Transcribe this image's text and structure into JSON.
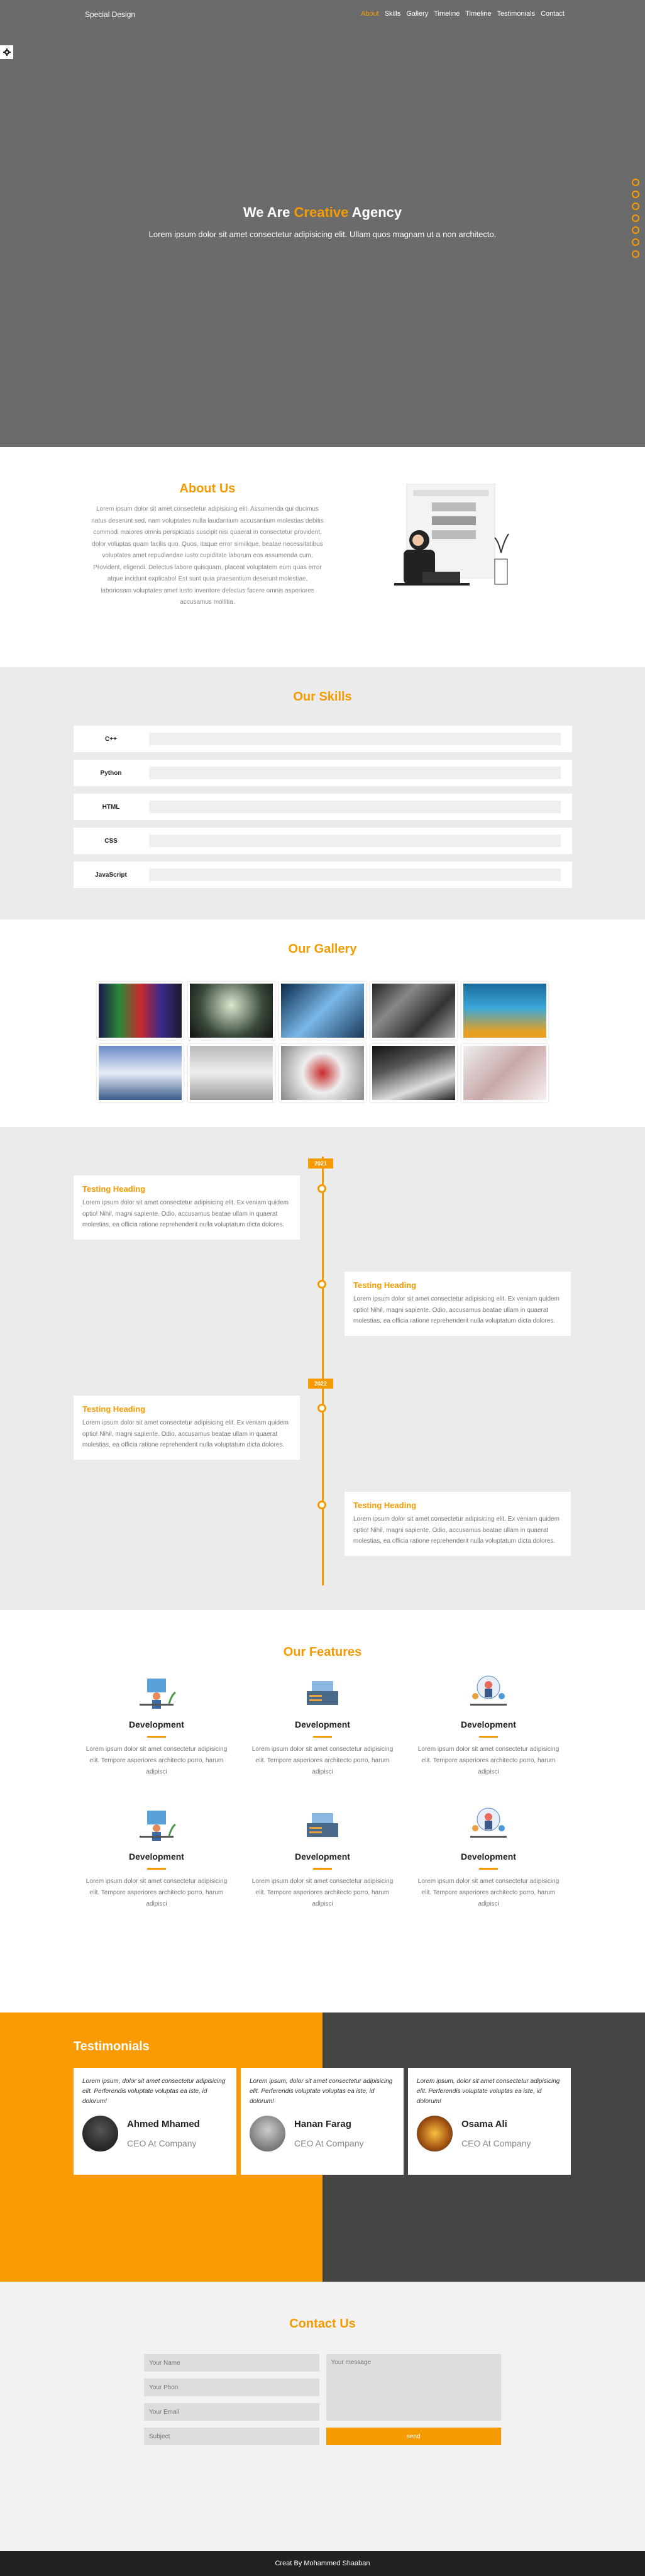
{
  "header": {
    "logo": "Special Design",
    "nav": [
      "About",
      "Skills",
      "Gallery",
      "Timeline",
      "Timeline",
      "Testimonials",
      "Contact"
    ]
  },
  "hero": {
    "title_pre": "We Are ",
    "title_hl": "Creative",
    "title_post": " Agency",
    "subtitle": "Lorem ipsum dolor sit amet consectetur adipisicing elit. Ullam quos magnam ut a non architecto."
  },
  "about": {
    "title": "About Us",
    "text": "Lorem ipsum dolor sit amet consectetur adipisicing elit. Assumenda qui ducimus natus deserunt sed, nam voluptates nulla laudantium accusantium molestias debitis commodi maiores omnis perspiciatis suscipit nisi quaerat in consectetur provident, dolor voluptas quam facilis quo. Quos, itaque error similique, beatae necessitatibus voluptates amet repudiandae iusto cupiditate laborum eos assumenda cum. Provident, eligendi. Delectus labore quisquam, placeat voluptatem eum quas error atque incidunt explicabo! Est sunt quia praesentium deserunt molestiae, laboriosam voluptates amet iusto inventore delectus facere omnis asperiores accusamus mollitia."
  },
  "skills": {
    "title": "Our Skills",
    "items": [
      "C++",
      "Python",
      "HTML",
      "CSS",
      "JavaScript"
    ]
  },
  "gallery": {
    "title": "Our Gallery"
  },
  "timeline": {
    "years": [
      "2021",
      "2022"
    ],
    "items": [
      {
        "heading": "Testing Heading",
        "text": "Lorem ipsum dolor sit amet consectetur adipisicing elit. Ex veniam quidem optio! Nihil, magni sapiente. Odio, accusamus beatae ullam in quaerat molestias, ea officia ratione reprehenderit nulla voluptatum dicta dolores."
      },
      {
        "heading": "Testing Heading",
        "text": "Lorem ipsum dolor sit amet consectetur adipisicing elit. Ex veniam quidem optio! Nihil, magni sapiente. Odio, accusamus beatae ullam in quaerat molestias, ea officia ratione reprehenderit nulla voluptatum dicta dolores."
      },
      {
        "heading": "Testing Heading",
        "text": "Lorem ipsum dolor sit amet consectetur adipisicing elit. Ex veniam quidem optio! Nihil, magni sapiente. Odio, accusamus beatae ullam in quaerat molestias, ea officia ratione reprehenderit nulla voluptatum dicta dolores."
      },
      {
        "heading": "Testing Heading",
        "text": "Lorem ipsum dolor sit amet consectetur adipisicing elit. Ex veniam quidem optio! Nihil, magni sapiente. Odio, accusamus beatae ullam in quaerat molestias, ea officia ratione reprehenderit nulla voluptatum dicta dolores."
      }
    ]
  },
  "features": {
    "title": "Our Features",
    "items": [
      {
        "heading": "Development",
        "text": "Lorem ipsum dolor sit amet consectetur adipisicing elit. Tempore asperiores architecto porro, harum adipisci"
      },
      {
        "heading": "Development",
        "text": "Lorem ipsum dolor sit amet consectetur adipisicing elit. Tempore asperiores architecto porro, harum adipisci"
      },
      {
        "heading": "Development",
        "text": "Lorem ipsum dolor sit amet consectetur adipisicing elit. Tempore asperiores architecto porro, harum adipisci"
      },
      {
        "heading": "Development",
        "text": "Lorem ipsum dolor sit amet consectetur adipisicing elit. Tempore asperiores architecto porro, harum adipisci"
      },
      {
        "heading": "Development",
        "text": "Lorem ipsum dolor sit amet consectetur adipisicing elit. Tempore asperiores architecto porro, harum adipisci"
      },
      {
        "heading": "Development",
        "text": "Lorem ipsum dolor sit amet consectetur adipisicing elit. Tempore asperiores architecto porro, harum adipisci"
      }
    ]
  },
  "testimonials": {
    "title": "Testimonials",
    "items": [
      {
        "quote": "Lorem ipsum, dolor sit amet consectetur adipisicing elit. Perferendis voluptate voluptas ea iste, id dolorum!",
        "name": "Ahmed Mhamed",
        "role": "CEO At Company"
      },
      {
        "quote": "Lorem ipsum, dolor sit amet consectetur adipisicing elit. Perferendis voluptate voluptas ea iste, id dolorum!",
        "name": "Hanan Farag",
        "role": "CEO At Company"
      },
      {
        "quote": "Lorem ipsum, dolor sit amet consectetur adipisicing elit. Perferendis voluptate voluptas ea iste, id dolorum!",
        "name": "Osama Ali",
        "role": "CEO At Company"
      }
    ]
  },
  "contact": {
    "title": "Contact Us",
    "name_placeholder": "Your Name",
    "phone_placeholder": "Your Phon",
    "email_placeholder": "Your Email",
    "subject_placeholder": "Subject",
    "message_placeholder": "Your message",
    "send_label": "send"
  },
  "footer": {
    "text": "Creat By Mohammed Shaaban"
  },
  "colors": {
    "accent": "#f59b00",
    "dark": "#444444",
    "hero_bg": "#6b6b6b"
  }
}
